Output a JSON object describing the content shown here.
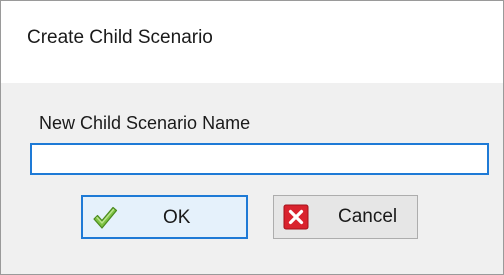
{
  "dialog": {
    "title": "Create Child Scenario",
    "field_label": "New Child Scenario Name",
    "name_input": {
      "value": "",
      "placeholder": ""
    },
    "buttons": {
      "ok": {
        "label": "OK",
        "icon": "check-icon"
      },
      "cancel": {
        "label": "Cancel",
        "icon": "close-icon"
      }
    }
  },
  "colors": {
    "focus_border": "#1e7ad6",
    "dialog_background": "#f0f0f0",
    "title_background": "#ffffff",
    "check_green": "#5aa625",
    "cancel_red": "#d9232e"
  }
}
